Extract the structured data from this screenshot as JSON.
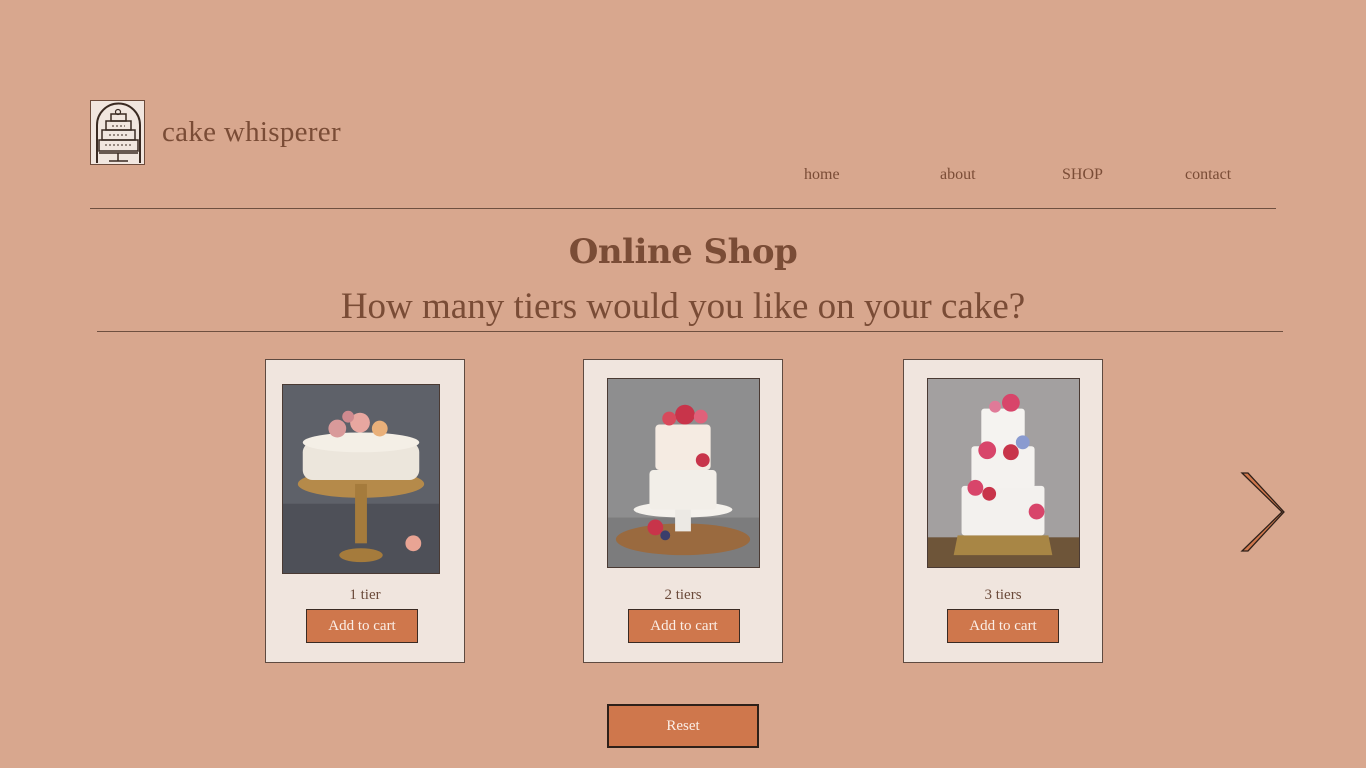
{
  "brand": {
    "name": "cake whisperer",
    "logo_icon": "cake-logo-icon"
  },
  "nav": {
    "items": [
      "home",
      "about",
      "SHOP",
      "contact"
    ]
  },
  "page": {
    "title": "Online Shop",
    "question": "How many tiers would you like on your cake?"
  },
  "products": [
    {
      "label": "1 tier",
      "button": "Add to cart",
      "image": "one-tier-cake-photo"
    },
    {
      "label": "2 tiers",
      "button": "Add to cart",
      "image": "two-tier-cake-photo"
    },
    {
      "label": "3 tiers",
      "button": "Add to cart",
      "image": "three-tier-cake-photo"
    }
  ],
  "controls": {
    "reset_label": "Reset",
    "next_icon": "chevron-right-icon"
  },
  "colors": {
    "background": "#d8a78e",
    "card": "#f0e5de",
    "button": "#cf774c",
    "text": "#7a4c36"
  }
}
